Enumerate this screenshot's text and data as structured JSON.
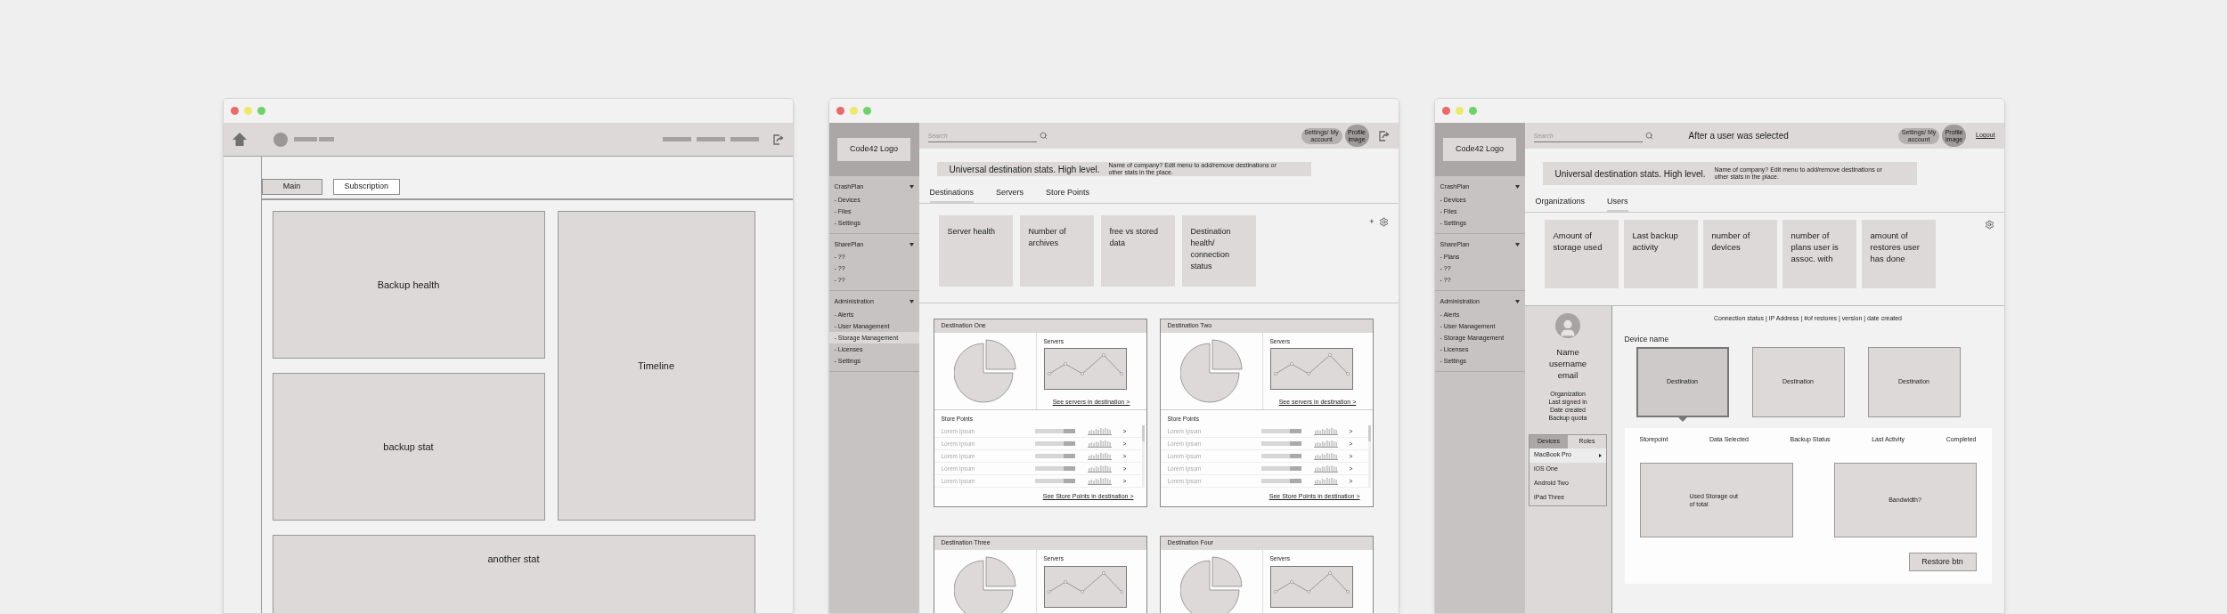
{
  "wireframe_main": {
    "tabs": [
      {
        "label": "Main",
        "selected": true
      },
      {
        "label": "Subscription",
        "selected": false
      }
    ],
    "panels": {
      "backup_health": "Backup health",
      "timeline": "Timeline",
      "backup_stat": "backup stat",
      "another_stat": "another stat"
    }
  },
  "wireframe_destinations": {
    "logo": "Code42 Logo",
    "search": {
      "placeholder": "Search"
    },
    "account": {
      "settings": "Settings/ My account",
      "profile": "Profile image"
    },
    "sidebar": [
      {
        "title": "CrashPlan",
        "expanded": true,
        "items": [
          {
            "label": "- Devices",
            "selected": false
          },
          {
            "label": "- Files",
            "selected": false
          },
          {
            "label": "- Settings",
            "selected": false
          }
        ]
      },
      {
        "title": "SharePlan",
        "expanded": true,
        "items": [
          {
            "label": "- ??",
            "selected": false
          },
          {
            "label": "- ??",
            "selected": false
          },
          {
            "label": "- ??",
            "selected": false
          }
        ]
      },
      {
        "title": "Administration",
        "expanded": true,
        "items": [
          {
            "label": "- Alerts",
            "selected": false
          },
          {
            "label": "- User Management",
            "selected": false
          },
          {
            "label": "- Storage Management",
            "selected": true
          },
          {
            "label": "- Licenses",
            "selected": false
          },
          {
            "label": "- Settings",
            "selected": false
          }
        ]
      }
    ],
    "banner": {
      "title": "Universal destination stats. High level.",
      "note": "Name of company? Edit menu to add/remove destinations or other stats in the place."
    },
    "tabs": [
      {
        "label": "Destinations",
        "selected": true
      },
      {
        "label": "Servers",
        "selected": false
      },
      {
        "label": "Store Points",
        "selected": false
      }
    ],
    "stat_cards": [
      "Server health",
      "Number of archives",
      "free vs stored data",
      "Destination health/ connection status"
    ],
    "add_button": "+",
    "destinations": [
      {
        "title": "Destination One",
        "servers_label": "Servers",
        "servers_link": "See servers in destination >",
        "store_points_title": "Store Points",
        "store_points": [
          {
            "name": "Lorem Ipsum",
            "level": 0.72,
            "arrow": ">"
          },
          {
            "name": "Lorem Ipsum",
            "level": 0.72,
            "arrow": ">"
          },
          {
            "name": "Lorem Ipsum",
            "level": 0.72,
            "arrow": ">"
          },
          {
            "name": "Lorem Ipsum",
            "level": 0.72,
            "arrow": ">"
          },
          {
            "name": "Lorem Ipsum",
            "level": 0.72,
            "arrow": ">"
          }
        ],
        "store_points_link": "See Store Points in destination >"
      },
      {
        "title": "Destination Two",
        "servers_label": "Servers",
        "servers_link": "See servers in destination >",
        "store_points_title": "Store Points",
        "store_points": [
          {
            "name": "Lorem Ipsum",
            "level": 0.72,
            "arrow": ">"
          },
          {
            "name": "Lorem Ipsum",
            "level": 0.72,
            "arrow": ">"
          },
          {
            "name": "Lorem Ipsum",
            "level": 0.72,
            "arrow": ">"
          },
          {
            "name": "Lorem Ipsum",
            "level": 0.72,
            "arrow": ">"
          },
          {
            "name": "Lorem Ipsum",
            "level": 0.72,
            "arrow": ">"
          }
        ],
        "store_points_link": "See Store Points in destination >"
      },
      {
        "title": "Destination Three",
        "servers_label": "Servers"
      },
      {
        "title": "Destination Four",
        "servers_label": "Servers"
      }
    ]
  },
  "wireframe_user": {
    "logo": "Code42 Logo",
    "search": {
      "placeholder": "Search"
    },
    "header_title": "After a user was selected",
    "account": {
      "settings": "Settings/ My account",
      "profile": "Profile image",
      "logout": "Logout"
    },
    "sidebar": [
      {
        "title": "CrashPlan",
        "expanded": true,
        "items": [
          {
            "label": "- Devices",
            "selected": false
          },
          {
            "label": "- Files",
            "selected": false
          },
          {
            "label": "- Settings",
            "selected": false
          }
        ]
      },
      {
        "title": "SharePlan",
        "expanded": true,
        "items": [
          {
            "label": "- Plans",
            "selected": false
          },
          {
            "label": "- ??",
            "selected": false
          },
          {
            "label": "- ??",
            "selected": false
          }
        ]
      },
      {
        "title": "Administration",
        "expanded": true,
        "items": [
          {
            "label": "- Alerts",
            "selected": false
          },
          {
            "label": "- User Management",
            "selected": false
          },
          {
            "label": "- Storage Management",
            "selected": false
          },
          {
            "label": "- Licenses",
            "selected": false
          },
          {
            "label": "- Settings",
            "selected": false
          }
        ]
      }
    ],
    "banner": {
      "title": "Universal destination stats. High level.",
      "note": "Name of company? Edit menu to add/remove destinations or other stats in the place."
    },
    "tabs": [
      {
        "label": "Organizations",
        "selected": false
      },
      {
        "label": "Users",
        "selected": true
      }
    ],
    "stat_cards": [
      "Amount of storage used",
      "Last backup activity",
      "number of devices",
      "number of plans user is assoc. with",
      "amount of restores user has done"
    ],
    "user": {
      "name": "Name",
      "username": "username",
      "email": "email",
      "details": [
        "Organization",
        "Last signed in",
        "Date created",
        "Backup quota"
      ]
    },
    "device_tabs": [
      {
        "label": "Devices",
        "selected": true
      },
      {
        "label": "Roles",
        "selected": false
      }
    ],
    "devices": [
      {
        "label": "MacBook Pro",
        "selected": true
      },
      {
        "label": "iOS One",
        "selected": false
      },
      {
        "label": "Android Two",
        "selected": false
      },
      {
        "label": "iPad Three",
        "selected": false
      }
    ],
    "connection_info": "Connection status | IP Address | #of restores | version | date created",
    "device_title": "Device name",
    "destinations": [
      {
        "label": "Destination",
        "selected": true
      },
      {
        "label": "Destination",
        "selected": false
      },
      {
        "label": "Destination",
        "selected": false
      }
    ],
    "columns": [
      "Storepoint",
      "Data Selected",
      "Backup Status",
      "Last Activity",
      "Completed"
    ],
    "storage_box": "Used Storage out of total",
    "bandwidth_box": "Bandwidth?",
    "restore_button": "Restore btn"
  }
}
